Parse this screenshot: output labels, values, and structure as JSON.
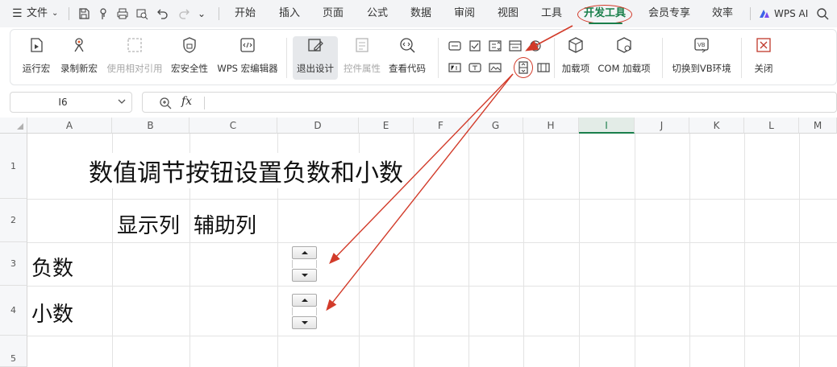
{
  "menubar": {
    "file_label": "文件",
    "tabs": [
      "开始",
      "插入",
      "页面",
      "公式",
      "数据",
      "审阅",
      "视图",
      "工具",
      "开发工具",
      "会员专享",
      "效率"
    ],
    "active_tab": "开发工具",
    "wps_ai": "WPS AI"
  },
  "ribbon": {
    "buttons": {
      "run_macro": "运行宏",
      "record_macro": "录制新宏",
      "relative_ref": "使用相对引用",
      "macro_security": "宏安全性",
      "wps_macro_editor": "WPS 宏编辑器",
      "exit_design": "退出设计",
      "control_props": "控件属性",
      "view_code": "查看代码",
      "addins": "加载项",
      "com_addins": "COM 加载项",
      "switch_vb": "切换到VB环境",
      "close": "关闭"
    },
    "disabled": [
      "使用相对引用",
      "控件属性"
    ],
    "pressed": "退出设计"
  },
  "formula_bar": {
    "name_box": "I6",
    "fx_label": "fx",
    "formula": ""
  },
  "sheet": {
    "columns": [
      "A",
      "B",
      "C",
      "D",
      "E",
      "F",
      "G",
      "H",
      "I",
      "J",
      "K",
      "L",
      "M"
    ],
    "selected_column": "I",
    "rows": [
      "1",
      "2",
      "3",
      "4",
      "5"
    ],
    "cells": {
      "title": "数值调节按钮设置负数和小数",
      "B2": "显示列",
      "C2": "辅助列",
      "A3": "负数",
      "A4": "小数"
    },
    "spin_buttons": [
      "负数",
      "小数"
    ]
  },
  "colors": {
    "accent": "#1a7f4b",
    "annotation": "#d23b2a"
  }
}
